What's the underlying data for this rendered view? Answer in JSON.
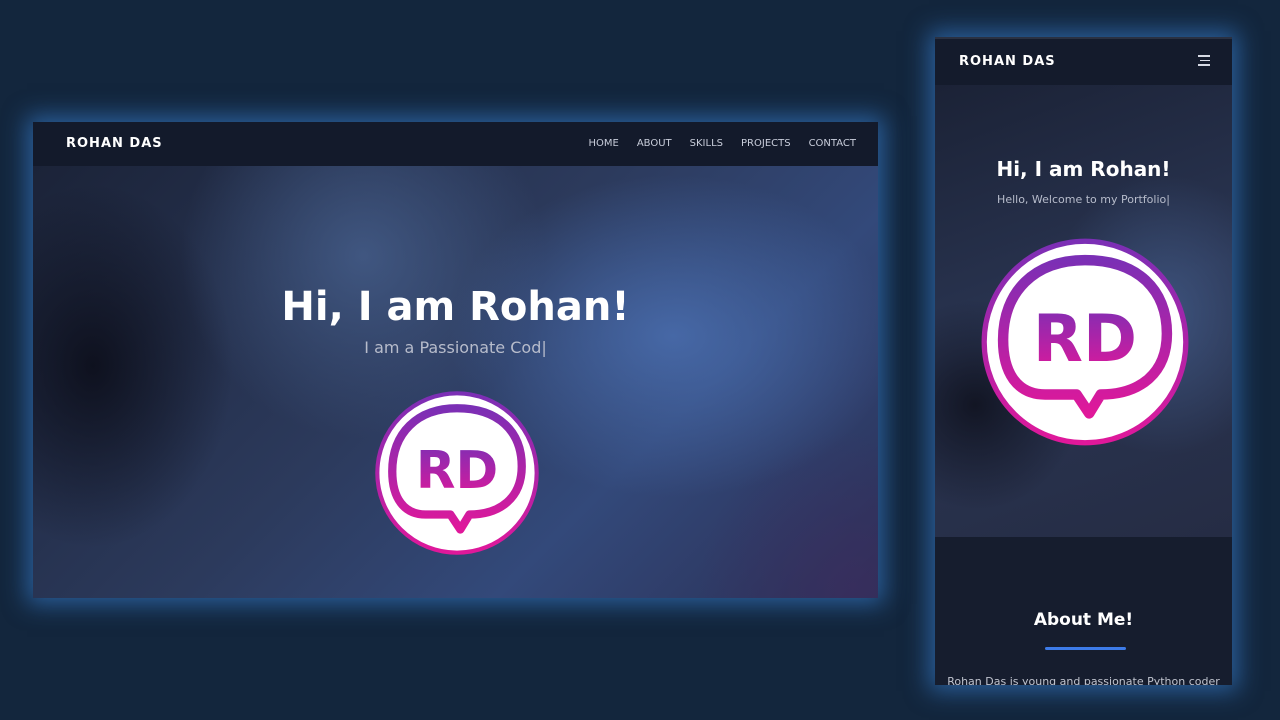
{
  "desktop": {
    "nav": {
      "brand": "ROHAN DAS",
      "links": [
        "HOME",
        "ABOUT",
        "SKILLS",
        "PROJECTS",
        "CONTACT"
      ]
    },
    "hero": {
      "title": "Hi, I am Rohan!",
      "subtitle": "I am a Passionate Cod|",
      "logo_text": "RD"
    }
  },
  "mobile": {
    "nav": {
      "brand": "ROHAN DAS",
      "menu_icon": "hamburger-icon"
    },
    "hero": {
      "title": "Hi, I am Rohan!",
      "subtitle": "Hello, Welcome to my Portfolio|",
      "logo_text": "RD"
    },
    "about": {
      "title": "About Me!",
      "text": "Rohan Das is young and passionate Python coder"
    }
  },
  "colors": {
    "background": "#13263d",
    "accent": "#3d7be8",
    "logo_gradient_start": "#7b2fb5",
    "logo_gradient_end": "#e0189a"
  }
}
